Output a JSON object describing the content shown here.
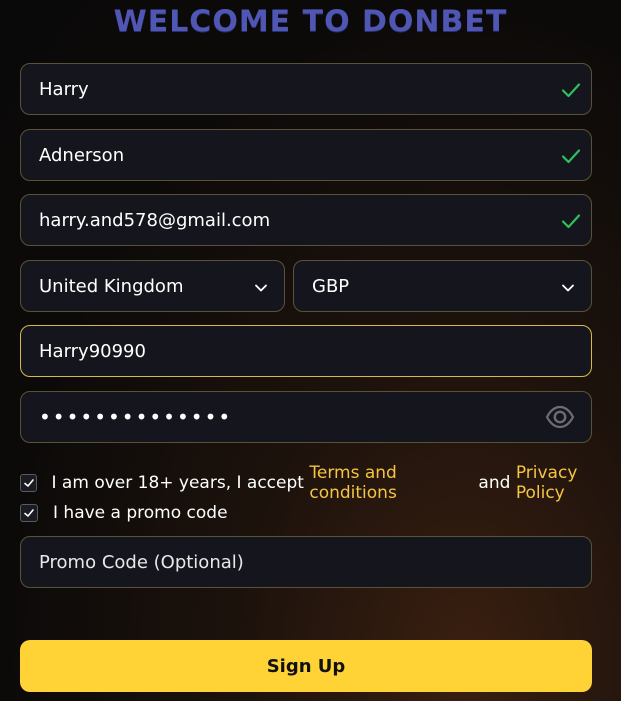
{
  "title": "WELCOME TO DONBET",
  "form": {
    "first_name": "Harry",
    "last_name": "Adnerson",
    "email": "harry.and578@gmail.com",
    "country": "United Kingdom",
    "currency": "GBP",
    "username": "Harry90990",
    "password_masked": "••••••••••••••",
    "promo_placeholder": "Promo Code (Optional)"
  },
  "agreement": {
    "text_before": "I am over 18+ years, I accept ",
    "terms_link": "Terms and conditions",
    "and_text": " and ",
    "privacy_link": "Privacy Policy",
    "checked": true
  },
  "promo_toggle": {
    "label": "I have a promo code",
    "checked": true
  },
  "signup_label": "Sign Up",
  "colors": {
    "accent": "#ffd236",
    "link": "#f5c542",
    "valid": "#2fbf5b",
    "title": "#4f56b3"
  },
  "icons": {
    "valid": "check-icon",
    "dropdown": "chevron-down-icon",
    "show_password": "eye-icon"
  }
}
